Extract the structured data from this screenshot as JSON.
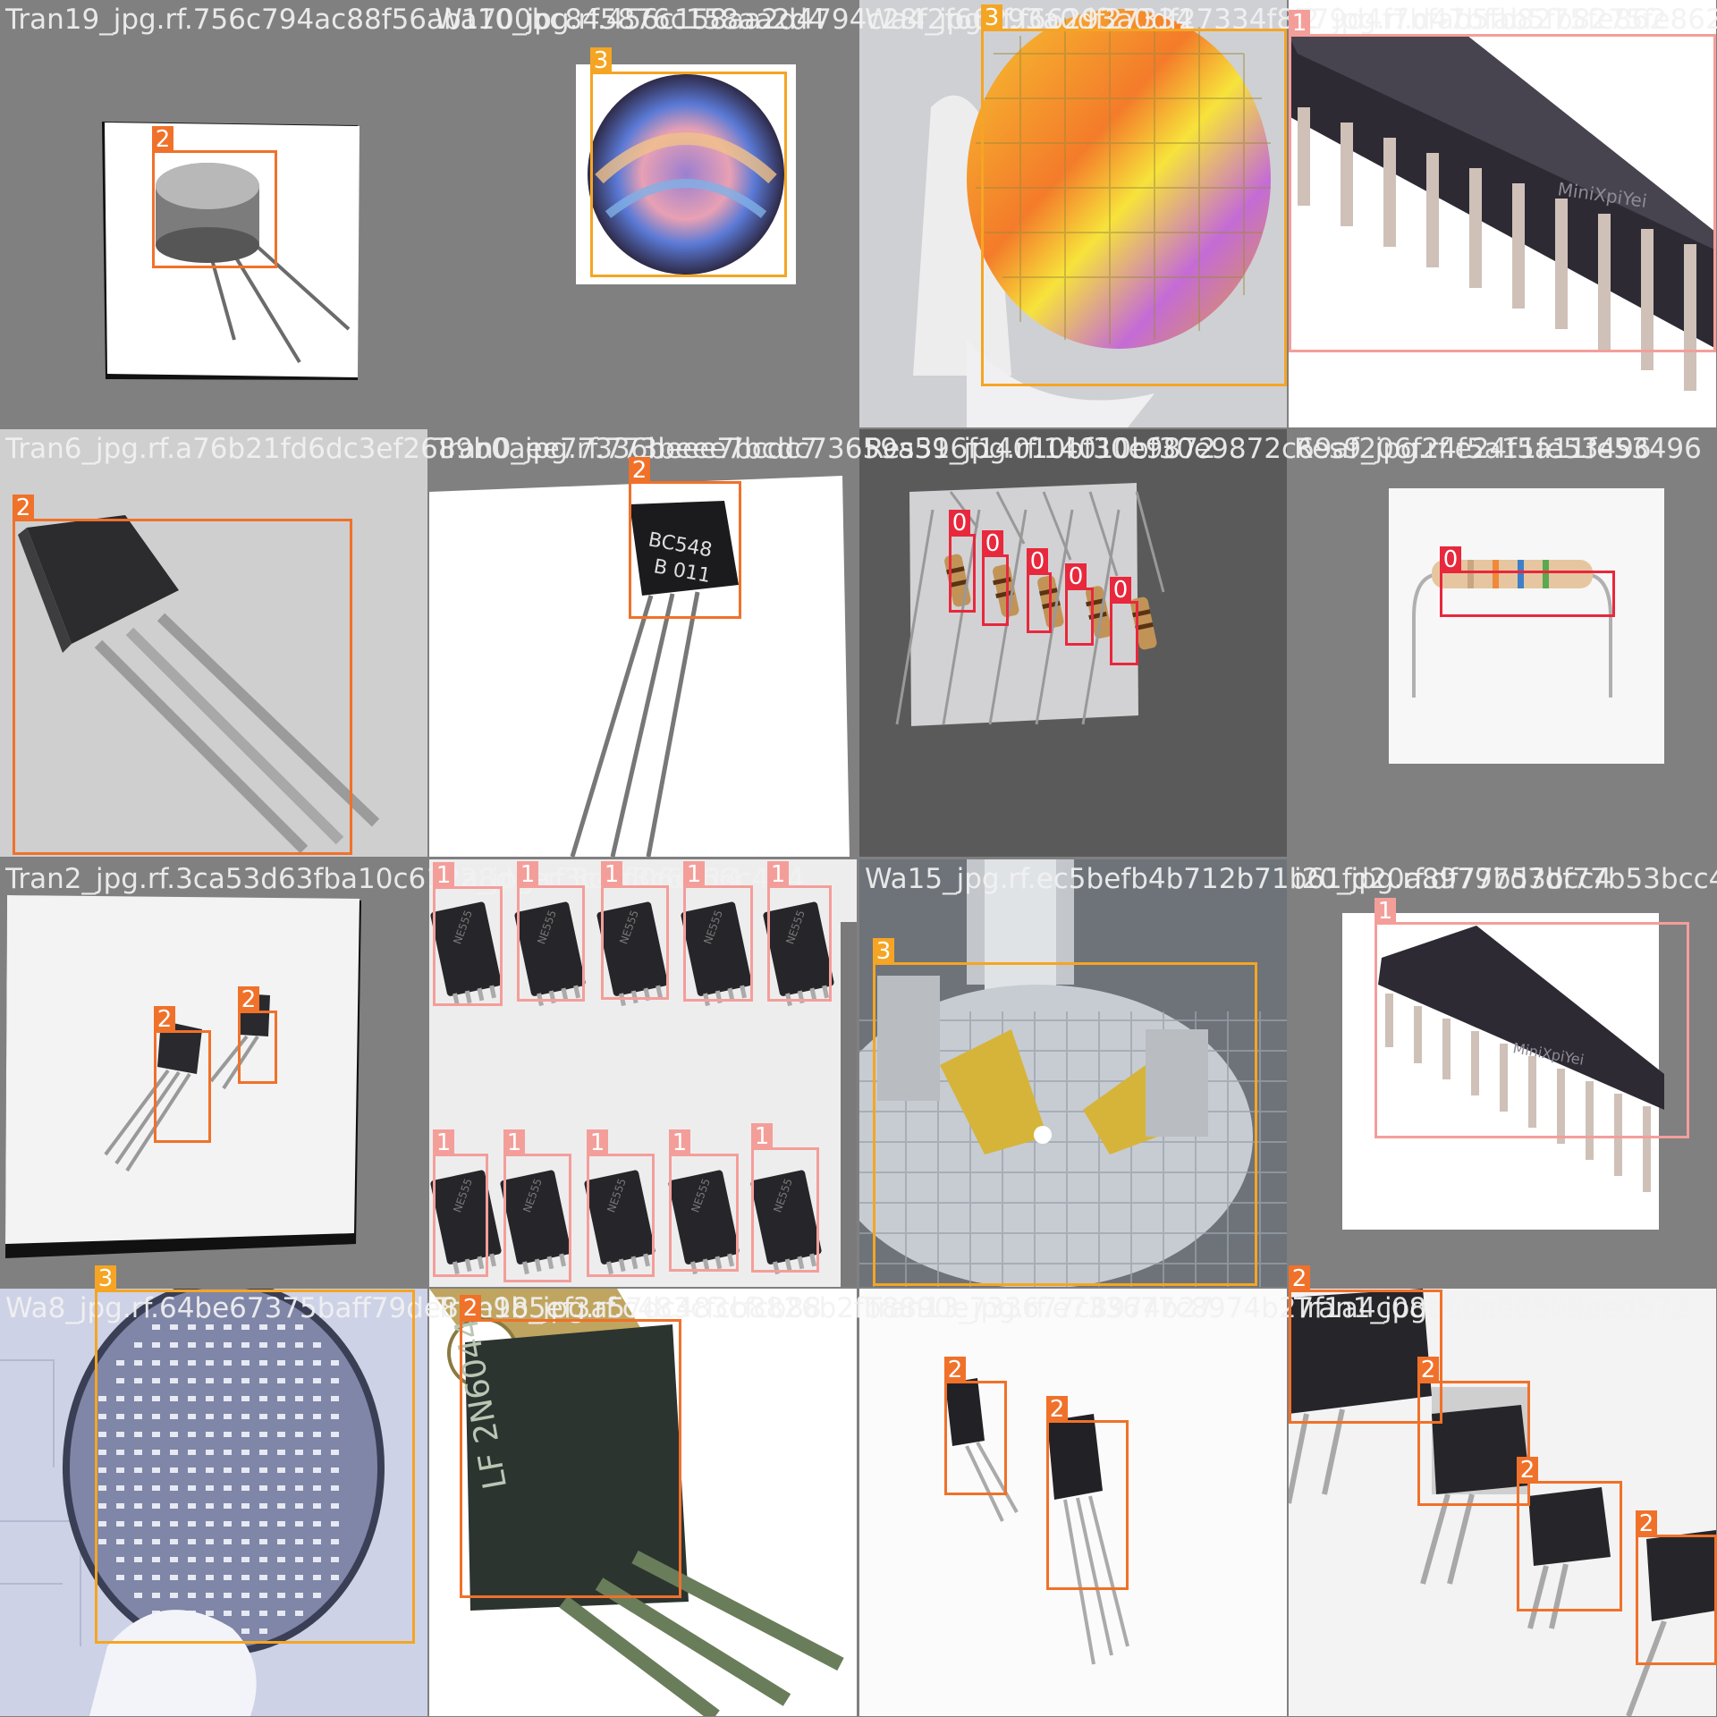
{
  "image": {
    "title": ""
  },
  "class_colors": {
    "0": "#e8283c",
    "1": "#f49e9a",
    "2": "#f0712a",
    "3": "#f5a523"
  },
  "tiles": [
    {
      "filename": "Tran19_jpg.rf.756c794ac88f56ab1700bc845876c158aa2d4",
      "scene": "to-can transistor on white",
      "boxes": [
        {
          "label": "2"
        }
      ]
    },
    {
      "filename": "Wa10_jpg.rf.456c158aa2d4794c28f2f66293a0df27334",
      "scene": "silicon wafer rainbow",
      "boxes": [
        {
          "label": "3"
        }
      ]
    },
    {
      "filename": "Wa4_jpg.rf.f66293a0df27334f8779d4f7bfab5fb8275fe862",
      "scene": "wafer in gloved hand",
      "boxes": [
        {
          "label": "3"
        }
      ]
    },
    {
      "filename": "i2_jpg.rf.d47bfab5fb8275fe862",
      "scene": "dip integrated circuit",
      "boxes": [
        {
          "label": "1"
        }
      ]
    },
    {
      "filename": "Tran6_jpg.rf.a76b21fd6dc3ef2689b0aee77336beee7bcdc7",
      "scene": "to-92 transistor grey",
      "boxes": [
        {
          "label": "2"
        }
      ]
    },
    {
      "filename": "Tran0_jpg.rf.773beee7bcdc73659a316f14010bf30e9872",
      "scene": "bc548 transistor",
      "boxes": [
        {
          "label": "2"
        }
      ]
    },
    {
      "filename": "Res59_jpg.rf.14010bf30e9872c69af206f24f5a11fe53496",
      "scene": "five resistors",
      "boxes": [
        {
          "label": "0"
        },
        {
          "label": "0"
        },
        {
          "label": "0"
        },
        {
          "label": "0"
        },
        {
          "label": "0"
        }
      ]
    },
    {
      "filename": "Res9_jpg.rf.e24f5a11fe53496",
      "scene": "single resistor",
      "boxes": [
        {
          "label": "0"
        }
      ]
    },
    {
      "filename": "Tran2_jpg.rf.3ca53d63fba10c612a8d1ec3c4ff3c6d66c414",
      "scene": "two transistors",
      "boxes": [
        {
          "label": "2"
        },
        {
          "label": "2"
        }
      ]
    },
    {
      "filename": "i12_jpg.rf.3c8d06c414",
      "scene": "ten soic chips",
      "boxes": [
        {
          "label": "1"
        },
        {
          "label": "1"
        },
        {
          "label": "1"
        },
        {
          "label": "1"
        },
        {
          "label": "1"
        },
        {
          "label": "1"
        },
        {
          "label": "1"
        },
        {
          "label": "1"
        },
        {
          "label": "1"
        },
        {
          "label": "1"
        }
      ]
    },
    {
      "filename": "Wa15_jpg.rf.ec5befb4b712b71b61fd20a89797d7df77b53bcc4",
      "scene": "wafer probe station",
      "boxes": [
        {
          "label": "3"
        }
      ]
    },
    {
      "filename": "i20_jpg.rf.df77b53bcc4",
      "scene": "dip ic on white",
      "boxes": [
        {
          "label": "1"
        }
      ]
    },
    {
      "filename": "Wa8_jpg.rf.64be67375baff79de87e9b5ef3a57dc483cfcb88",
      "scene": "wafer in hand blue",
      "boxes": [
        {
          "label": "3"
        }
      ]
    },
    {
      "filename": "Tran18_jpg.rf.c483cfcb8826b2fb8890e733677c8974b27",
      "scene": "to-220 closeup",
      "boxes": [
        {
          "label": "2"
        }
      ]
    },
    {
      "filename": "Tran13_jpg.rf.e733677c8974b27f1a4c08bb0aed572",
      "scene": "two small transistors",
      "boxes": [
        {
          "label": "2"
        },
        {
          "label": "2"
        }
      ]
    },
    {
      "filename": "Tran1_jpg.rf.dc08bb0aed572",
      "scene": "four transistors diagonal",
      "boxes": [
        {
          "label": "2"
        },
        {
          "label": "2"
        },
        {
          "label": "2"
        },
        {
          "label": "2"
        }
      ]
    }
  ]
}
